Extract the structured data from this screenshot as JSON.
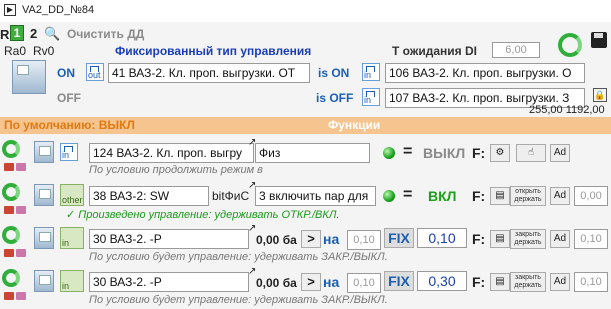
{
  "window": {
    "title": "VA2_DD_№84"
  },
  "header": {
    "page1": "1",
    "page2": "2",
    "clear_label": "Очистить ДД",
    "ra": "Ra0",
    "rv": "Rv0",
    "fixed_type_label": "Фиксированный тип управления",
    "wait_label": "Т ожидания DI",
    "wait_value": "6,00",
    "on_label": "ON",
    "off_label": "OFF",
    "out_label": "out",
    "control_field": "41 ВАЗ-2. Кл. проп. выгрузки. ОТ",
    "is_on_label": "is ON",
    "is_off_label": "is OFF",
    "in_label": "in",
    "is_on_field": "106 ВАЗ-2. Кл. проп. выгрузки. О",
    "is_off_field": "107 ВАЗ-2. Кл. проп. выгрузки. З",
    "values": "255,00 1192,00"
  },
  "section": {
    "default_label": "По умолчанию: ВЫКЛ",
    "functions_label": "Функции"
  },
  "rows": [
    {
      "io_label": "in",
      "field": "124 ВАЗ-2. Кл. проп. выгру",
      "field2": "Физ",
      "state": "ВЫКЛ",
      "state_color": "#8a8a8a",
      "f_label": "F:",
      "hint": "По условию продолжить режим в",
      "hint_color": "#777777"
    },
    {
      "io_label": "other",
      "field": "38 ВАЗ-2: SW",
      "mid": "bitФиС",
      "field2": "3 включить пар для",
      "state": "ВКЛ",
      "state_color": "#1aa31a",
      "f_label": "F:",
      "btn_label": "открыть держать",
      "value": "0,00",
      "hint": "✓ Произведено управление: удерживать ОТКР./ВКЛ.",
      "hint_color": "#1a9a1a"
    },
    {
      "io_label": "in",
      "field": "30 ВАЗ-2. -P",
      "num": "0,00 ба",
      "cmp": ">",
      "na": "на",
      "na_val": "0,10",
      "fix": "FIX",
      "fix_val": "0,10",
      "f_label": "F:",
      "btn_label": "закрыть держать",
      "value": "0,10",
      "hint": "По условию будет управление: удерживать ЗАКР./ВЫКЛ.",
      "hint_color": "#777777"
    },
    {
      "io_label": "in",
      "field": "30 ВАЗ-2. -P",
      "num": "0,00 ба",
      "cmp": ">",
      "na": "на",
      "na_val": "0,10",
      "fix": "FIX",
      "fix_val": "0,30",
      "f_label": "F:",
      "btn_label": "закрыть держать",
      "value": "0,10",
      "hint": "По условию будет управление: удерживать ЗАКР./ВЫКЛ.",
      "hint_color": "#777777"
    }
  ],
  "colors": {
    "accent_blue": "#1a5fb4",
    "orange": "#e0862a",
    "green": "#1aa31a"
  }
}
